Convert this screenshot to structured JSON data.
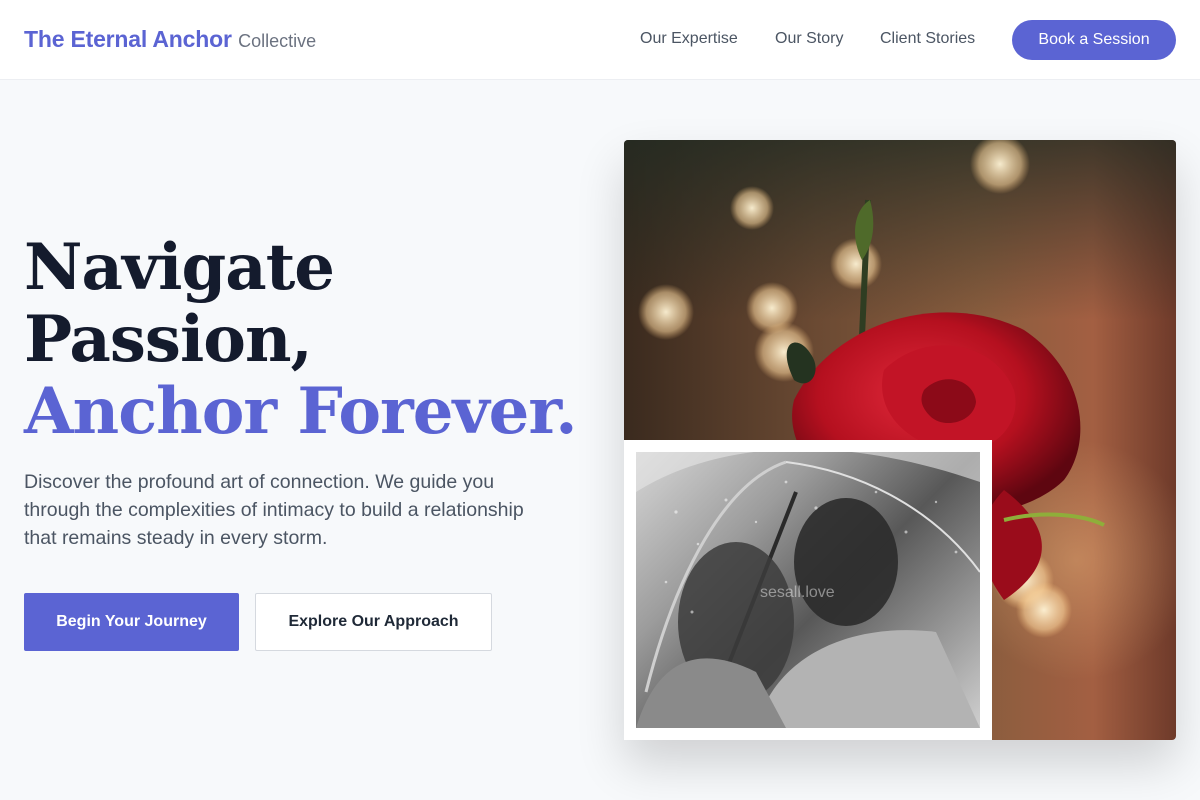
{
  "header": {
    "brand_name": "The Eternal Anchor",
    "brand_suffix": "Collective",
    "nav": [
      "Our Expertise",
      "Our Story",
      "Client Stories"
    ],
    "cta_label": "Book a Session"
  },
  "hero": {
    "headline_line1": "Navigate",
    "headline_line2": "Passion,",
    "headline_accent": "Anchor Forever.",
    "lead": "Discover the profound art of connection. We guide you through the complexities of intimacy to build a relationship that remains steady in every storm.",
    "primary_button": "Begin Your Journey",
    "secondary_button": "Explore Our Approach"
  },
  "images": {
    "main_alt": "Red rose with warm bokeh lights",
    "inset_alt": "Couple embracing under a clear umbrella in the rain",
    "watermark": "sesall.love"
  },
  "colors": {
    "accent": "#5b64d3",
    "headline": "#141b2d",
    "background": "#f7f9fb"
  }
}
